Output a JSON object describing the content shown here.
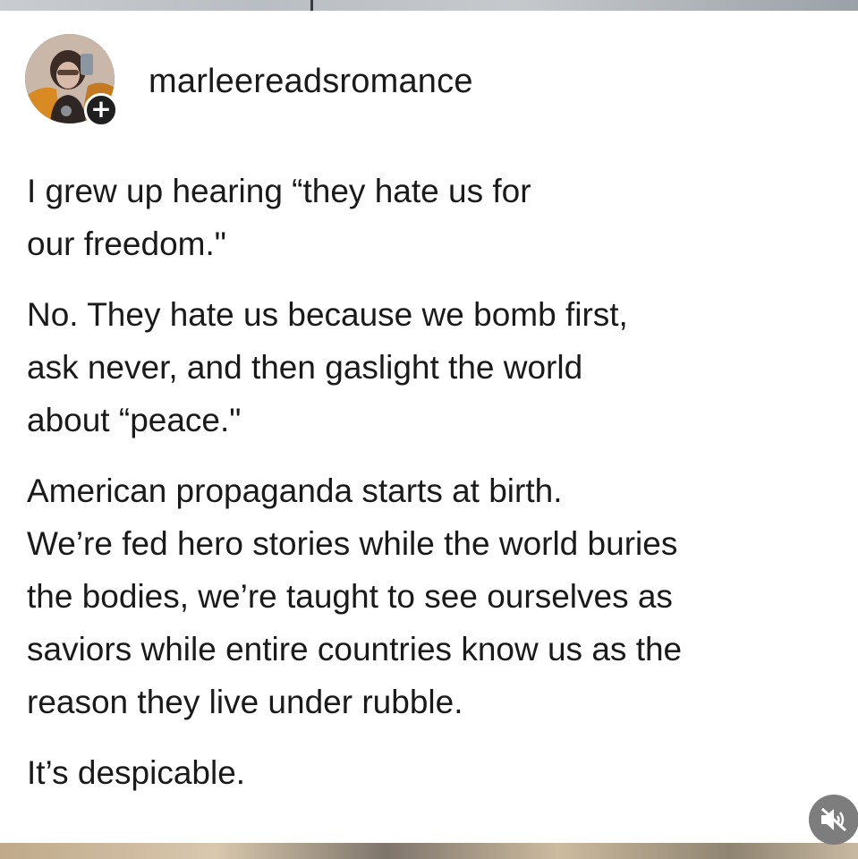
{
  "post": {
    "username": "marleereadsromance",
    "follow_icon": "plus-icon",
    "paragraphs": [
      {
        "lines": [
          "I grew up hearing “they hate us for",
          "our freedom.\""
        ]
      },
      {
        "lines": [
          "No. They hate us because we bomb first,",
          "ask never, and then gaslight the world",
          "about “peace.\""
        ]
      },
      {
        "lines": [
          "American propaganda starts at birth.",
          "We’re fed hero stories while the world buries",
          "the bodies, we’re taught to see ourselves as",
          "saviors while entire countries know us as the",
          "reason they live under rubble."
        ]
      },
      {
        "lines": [
          "It’s despicable."
        ]
      }
    ]
  },
  "controls": {
    "mute_icon": "speaker-muted-icon"
  },
  "colors": {
    "text": "#1a1a1a",
    "background": "#ffffff",
    "mute_button": "#7d7d7d"
  }
}
